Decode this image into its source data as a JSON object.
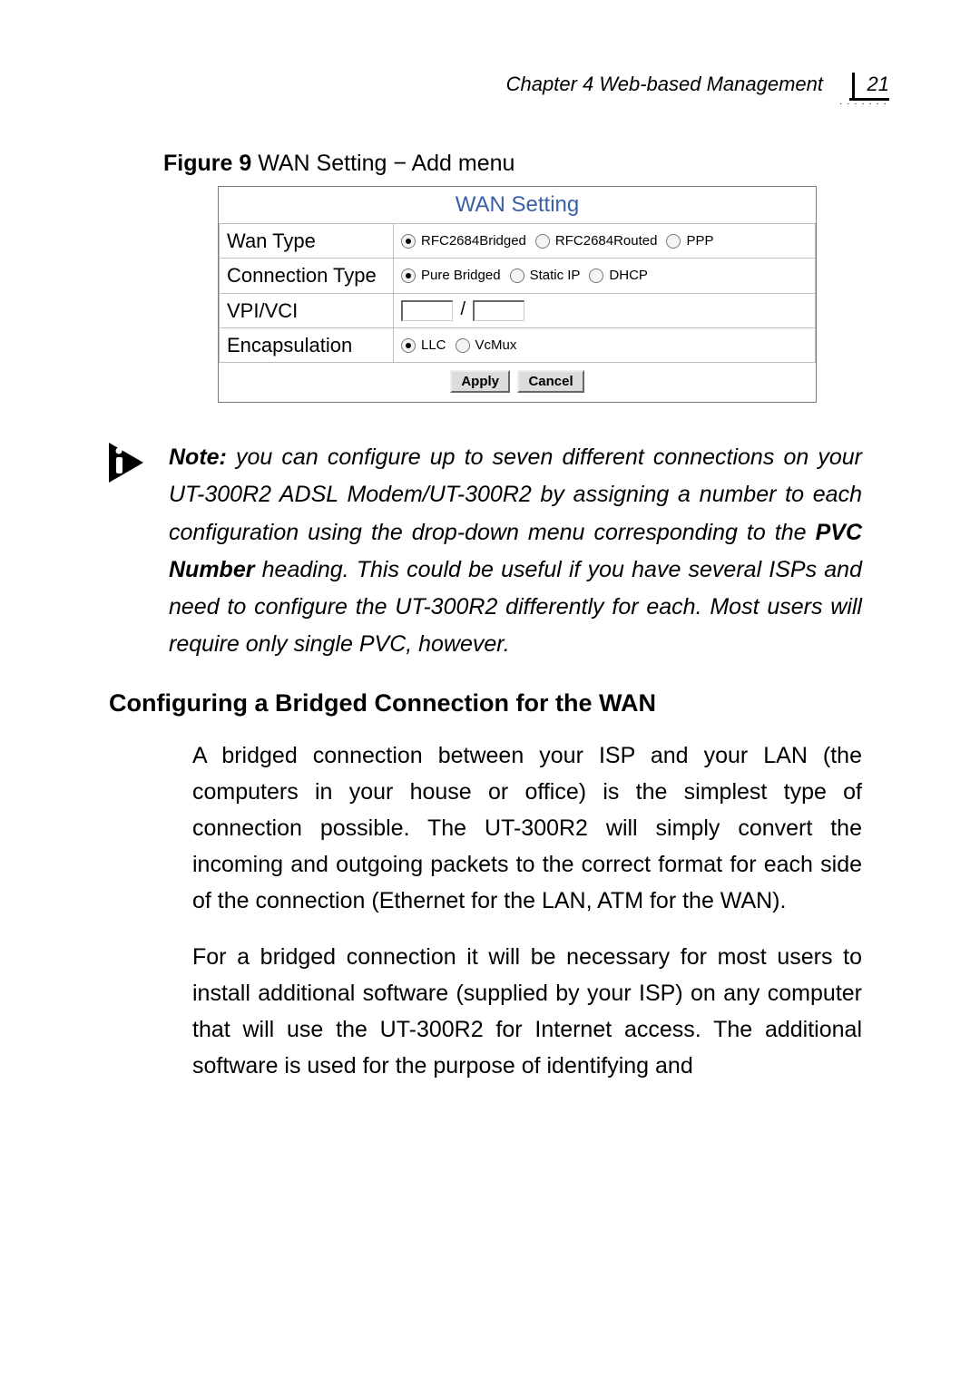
{
  "header": {
    "title": "Chapter 4 Web-based Management",
    "page_number": "21"
  },
  "figure": {
    "label": "Figure 9",
    "title": " WAN Setting − Add menu"
  },
  "wan": {
    "heading": "WAN Setting",
    "rows": {
      "wan_type": {
        "label": "Wan Type",
        "opt1": "RFC2684Bridged",
        "opt2": "RFC2684Routed",
        "opt3": "PPP",
        "selected": "RFC2684Bridged"
      },
      "conn_type": {
        "label": "Connection Type",
        "opt1": "Pure Bridged",
        "opt2": "Static IP",
        "opt3": "DHCP",
        "selected": "Pure Bridged"
      },
      "vpi_vci": {
        "label": "VPI/VCI",
        "vpi": "",
        "vci": ""
      },
      "encap": {
        "label": "Encapsulation",
        "opt1": "LLC",
        "opt2": "VcMux",
        "selected": "LLC"
      }
    },
    "buttons": {
      "apply": "Apply",
      "cancel": "Cancel"
    }
  },
  "note": {
    "lead": "Note:",
    "rest_before_pvc": " you can configure up to seven different connections on your UT-300R2 ADSL Modem/UT-300R2 by assigning a number to each configuration using the drop-down menu corresponding to the ",
    "pvc": "PVC Number",
    "rest_after_pvc": " heading. This could be useful if you have several ISPs and need to configure the UT-300R2 differently for each. Most users will require only single PVC, however."
  },
  "section": {
    "heading": "Configuring a Bridged Connection for the WAN",
    "para1": "A bridged connection between your ISP and your LAN (the computers in your house or office) is the simplest type of connection possible. The UT-300R2 will simply convert the incoming and outgoing packets to the correct format for each side of the connection (Ethernet for the LAN, ATM for the WAN).",
    "para2": "For a bridged connection it will be necessary for most users to install additional software (supplied by your ISP) on any computer that will use the UT-300R2 for Internet access. The additional software is used for the purpose of identifying and"
  }
}
